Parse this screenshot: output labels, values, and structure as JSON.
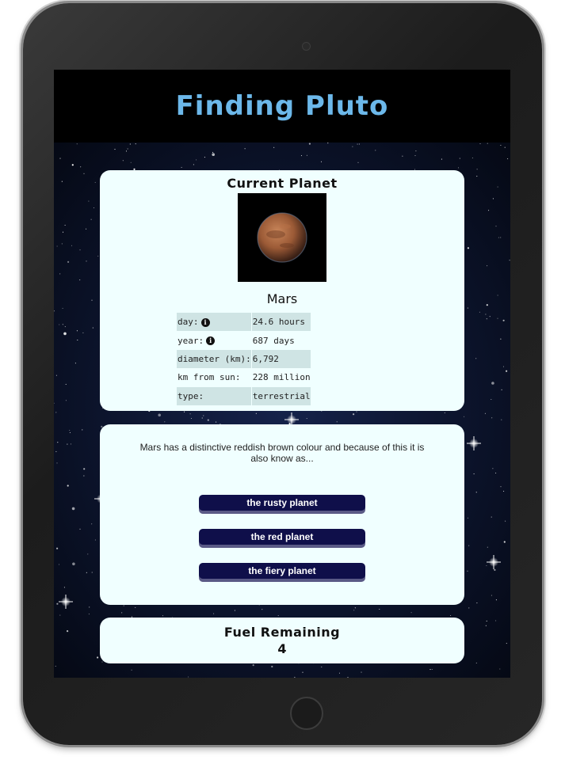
{
  "header": {
    "title": "Finding Pluto"
  },
  "planet_card": {
    "heading": "Current Planet",
    "planet_name": "Mars",
    "image_alt": "Mars",
    "facts": [
      {
        "label": "day:",
        "value": "24.6 hours",
        "info": true
      },
      {
        "label": "year:",
        "value": "687 days",
        "info": true
      },
      {
        "label": "diameter (km):",
        "value": "6,792",
        "info": false
      },
      {
        "label": "km from sun:",
        "value": "228 million",
        "info": false
      },
      {
        "label": "type:",
        "value": "terrestrial",
        "info": false
      }
    ]
  },
  "question_card": {
    "question": "Mars has a distinctive reddish brown colour and because of this it is also know as...",
    "answers": [
      "the rusty planet",
      "the red planet",
      "the fiery planet"
    ]
  },
  "fuel_card": {
    "heading": "Fuel Remaining",
    "value": "4"
  },
  "colors": {
    "title": "#6cb8ea",
    "card_bg": "#f0ffff",
    "button_bg": "#0f0f4a",
    "button_shadow": "#5a5a86",
    "table_shade": "#cfe4e4"
  },
  "icons": {
    "info": "info-circle-icon"
  }
}
